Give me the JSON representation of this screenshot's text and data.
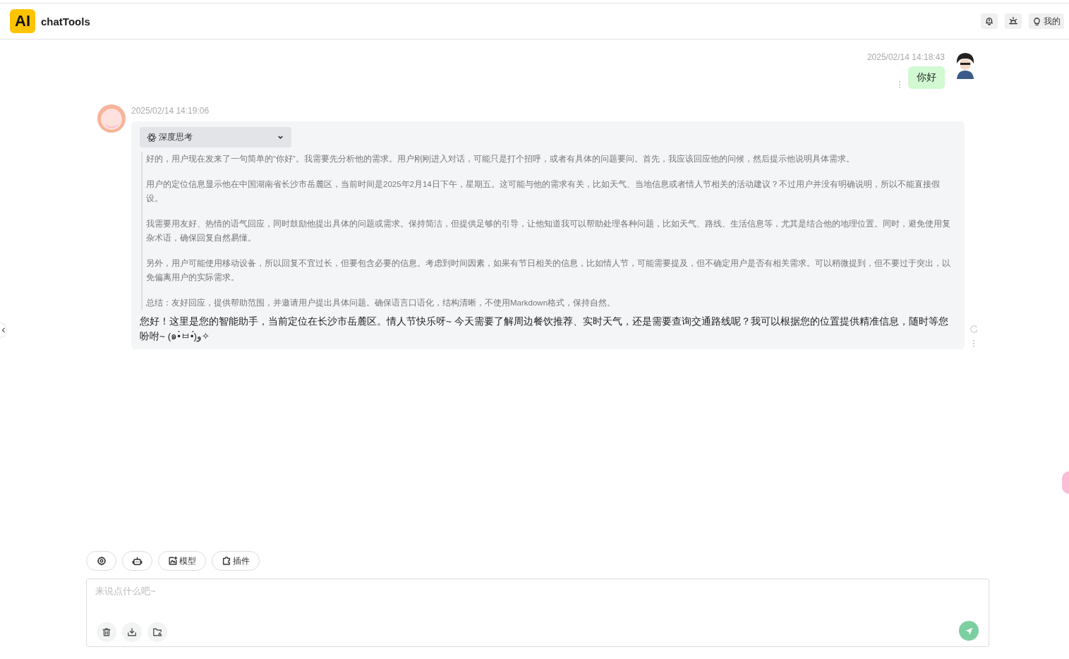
{
  "app": {
    "logo": "AI",
    "title": "chatTools"
  },
  "header_actions": [
    {
      "kind": "bell"
    },
    {
      "kind": "sun"
    },
    {
      "kind": "user",
      "label": "我的"
    }
  ],
  "messages": [
    {
      "kind": "user",
      "time": "2025/02/14 14:18:43",
      "text": "你好"
    },
    {
      "kind": "assistant",
      "time": "2025/02/14 14:19:06",
      "thinking": {
        "label": "深度思考",
        "expanded": true,
        "paragraphs": [
          "好的，用户现在发来了一句简单的“你好”。我需要先分析他的需求。用户刚刚进入对话，可能只是打个招呼，或者有具体的问题要问。首先，我应该回应他的问候，然后提示他说明具体需求。",
          "用户的定位信息显示他在中国湖南省长沙市岳麓区，当前时间是2025年2月14日下午，星期五。这可能与他的需求有关，比如天气、当地信息或者情人节相关的活动建议？不过用户并没有明确说明，所以不能直接假设。",
          "我需要用友好、热情的语气回应，同时鼓励他提出具体的问题或需求。保持简洁，但提供足够的引导，让他知道我可以帮助处理各种问题，比如天气、路线、生活信息等，尤其是结合他的地理位置。同时，避免使用复杂术语，确保回复自然易懂。",
          "另外，用户可能使用移动设备，所以回复不宜过长，但要包含必要的信息。考虑到时间因素，如果有节日相关的信息，比如情人节，可能需要提及，但不确定用户是否有相关需求。可以稍微提到，但不要过于突出，以免偏离用户的实际需求。",
          "总结：友好回应，提供帮助范围，并邀请用户提出具体问题。确保语言口语化，结构清晰，不使用Markdown格式，保持自然。"
        ]
      },
      "text": "您好！这里是您的智能助手，当前定位在长沙市岳麓区。情人节快乐呀~ 今天需要了解周边餐饮推荐、实时天气，还是需要查询交通路线呢？我可以根据您的位置提供精准信息，随时等您吩咐~ (๑•̀ㅂ•́)و✧"
    }
  ],
  "toolbar": [
    {
      "kind": "settings"
    },
    {
      "kind": "robot"
    },
    {
      "kind": "model",
      "label": "模型"
    },
    {
      "kind": "plugin",
      "label": "插件"
    }
  ],
  "composer": {
    "placeholder": "来说点什么吧~",
    "actions": [
      {
        "kind": "trash"
      },
      {
        "kind": "download"
      },
      {
        "kind": "folder"
      }
    ]
  }
}
